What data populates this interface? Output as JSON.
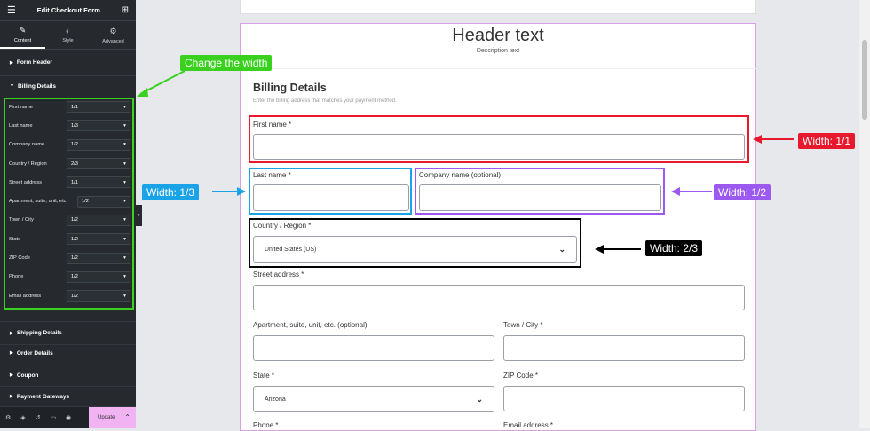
{
  "sidebar": {
    "title": "Edit Checkout Form",
    "tabs": [
      {
        "label": "Content",
        "icon": "pencil-icon"
      },
      {
        "label": "Style",
        "icon": "half-circle-icon"
      },
      {
        "label": "Advanced",
        "icon": "gear-icon"
      }
    ],
    "sections_top": [
      "Form Header",
      "Billing Details"
    ],
    "billing_fields": [
      {
        "label": "First name",
        "value": "1/1"
      },
      {
        "label": "Last name",
        "value": "1/3"
      },
      {
        "label": "Company name",
        "value": "1/2"
      },
      {
        "label": "Country / Region",
        "value": "2/3"
      },
      {
        "label": "Street address",
        "value": "1/1"
      },
      {
        "label": "Apartment, suite, unit, etc.",
        "value": "1/2"
      },
      {
        "label": "Town / City",
        "value": "1/2"
      },
      {
        "label": "State",
        "value": "1/2"
      },
      {
        "label": "ZIP Code",
        "value": "1/2"
      },
      {
        "label": "Phone",
        "value": "1/2"
      },
      {
        "label": "Email address",
        "value": "1/2"
      }
    ],
    "sections_bottom": [
      "Shipping Details",
      "Order Details",
      "Coupon",
      "Payment Gateways"
    ],
    "update_label": "Update"
  },
  "form": {
    "header_text": "Header text",
    "description_text": "Description text",
    "billing_title": "Billing Details",
    "billing_subtitle": "Enter the billing address that matches your payment method.",
    "first_name": "First name *",
    "last_name": "Last name *",
    "company_name": "Company name (optional)",
    "country": "Country / Region *",
    "country_value": "United States (US)",
    "street": "Street address *",
    "apartment": "Apartment, suite, unit, etc. (optional)",
    "town": "Town / City *",
    "state": "State *",
    "state_value": "Arizona",
    "zip": "ZIP Code *",
    "phone": "Phone *",
    "email": "Email address *"
  },
  "annotations": {
    "change_width": "Change the width",
    "width_1_1": "Width: 1/1",
    "width_1_3": "Width: 1/3",
    "width_1_2": "Width: 1/2",
    "width_2_3": "Width: 2/3"
  },
  "colors": {
    "green": "#39d11e",
    "red": "#e8192c",
    "blue": "#1ba3e8",
    "purple": "#9b59f0",
    "black": "#000000"
  }
}
